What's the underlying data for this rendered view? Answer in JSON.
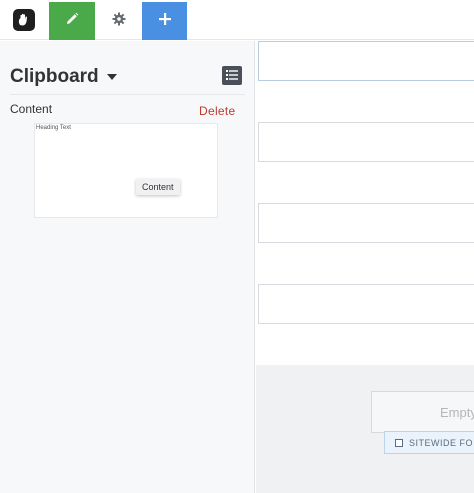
{
  "toolbar": {
    "logo_icon": "concrete-hand-logo-icon",
    "edit_icon": "pencil-icon",
    "settings_icon": "gear-icon",
    "add_icon": "plus-icon",
    "colors": {
      "edit": "#4aa948",
      "add": "#4a90e2"
    }
  },
  "panel": {
    "title": "Clipboard",
    "list_icon": "list-icon",
    "section_label": "Content",
    "delete_label": "Delete",
    "item": {
      "preview_heading": "Heading Text",
      "tag": "Content"
    }
  },
  "main": {
    "footer": {
      "empty_text": "Empty",
      "sitewide_label": "SITEWIDE FO"
    }
  }
}
